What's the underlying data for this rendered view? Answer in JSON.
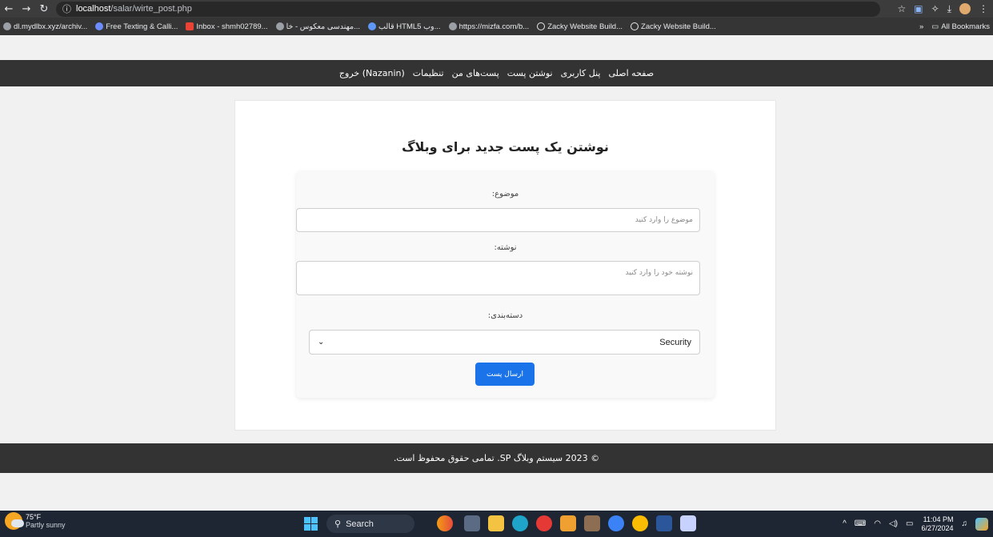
{
  "browser": {
    "url_host": "localhost",
    "url_path": "/salar/wirte_post.php",
    "bookmarks": [
      "dl.mydlbx.xyz/archiv...",
      "Free Texting & Calli...",
      "Inbox - shmh02789...",
      "مهندسی معکوس - خا...",
      "قالب HTML5 وب...",
      "https://mizfa.com/b...",
      "Zacky Website Build...",
      "Zacky Website Build..."
    ],
    "all_bookmarks": "All Bookmarks"
  },
  "header": {
    "nav": [
      "صفحه اصلی",
      "پنل کاربری",
      "نوشتن پست",
      "پست‌های من",
      "تنظیمات",
      "(Nazanin) خروج"
    ]
  },
  "form": {
    "title": "نوشتن یک پست جدید برای وبلاگ",
    "subject_label": "موضوع:",
    "subject_placeholder": "موضوع را وارد کنید",
    "body_label": "نوشته:",
    "body_placeholder": "نوشته خود را وارد کنید",
    "category_label": "دسته‌بندی:",
    "category_value": "Security",
    "submit_label": "ارسال پست"
  },
  "footer": {
    "text": "© 2023 سیستم وبلاگ SP. تمامی حقوق محفوظ است."
  },
  "taskbar": {
    "temperature": "75°F",
    "weather": "Partly sunny",
    "search": "Search",
    "time": "11:04 PM",
    "date": "6/27/2024"
  }
}
